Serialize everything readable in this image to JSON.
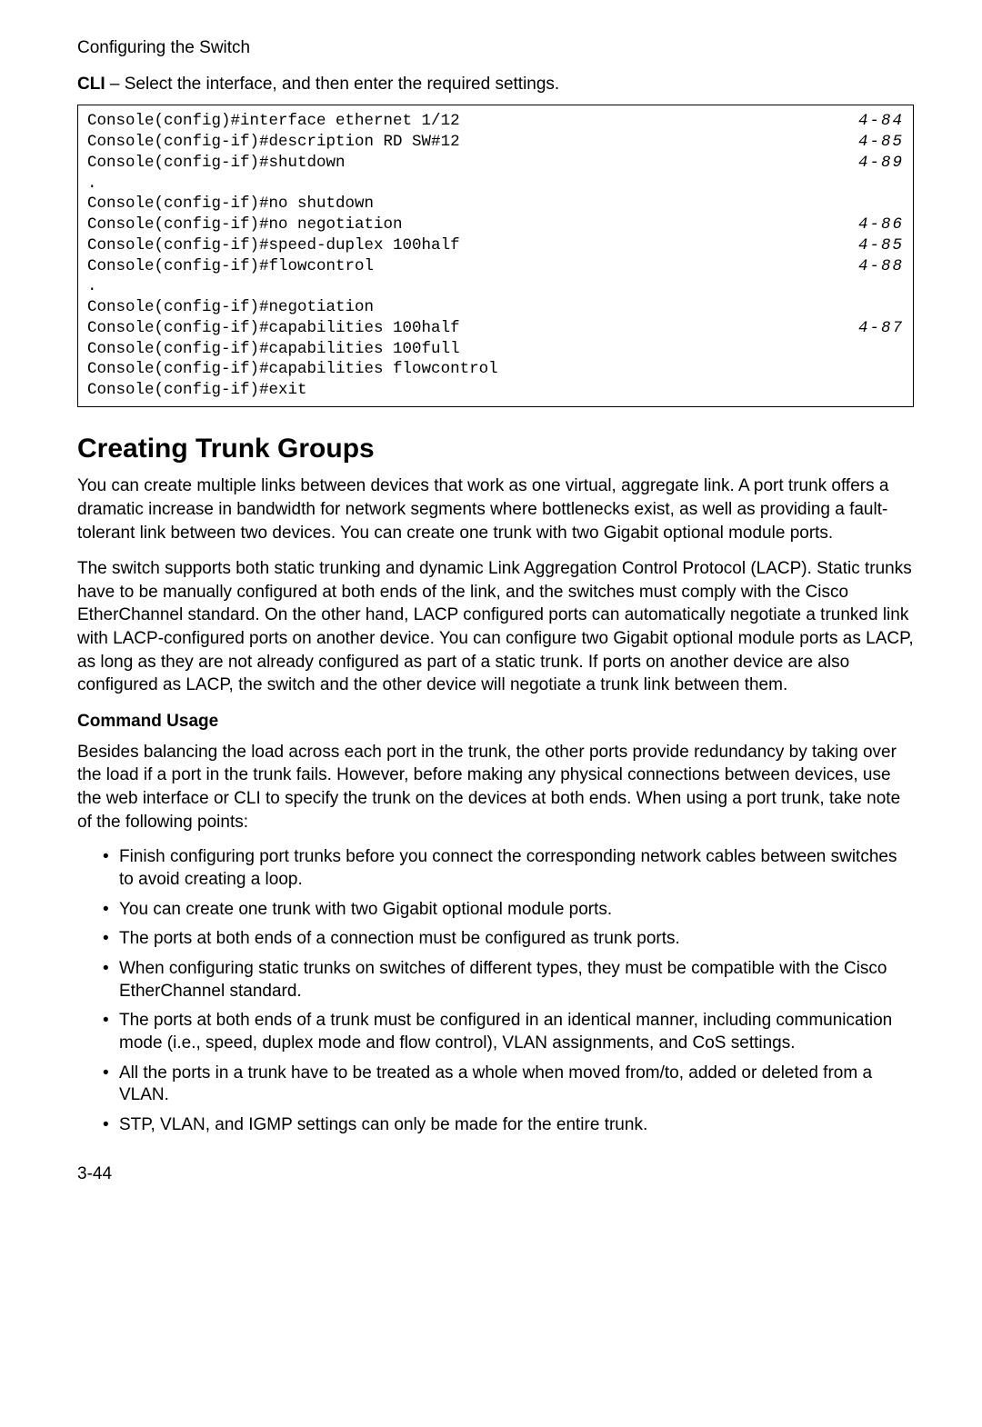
{
  "header": "Configuring the Switch",
  "cli_intro_prefix": "CLI",
  "cli_intro_rest": " – Select the interface, and then enter the required settings.",
  "code_rows": [
    {
      "left": "Console(config)#interface ethernet 1/12",
      "right": "4-84"
    },
    {
      "left": "Console(config-if)#description RD SW#12",
      "right": "4-85"
    },
    {
      "left": "Console(config-if)#shutdown",
      "right": "4-89"
    },
    {
      "left": ".",
      "right": ""
    },
    {
      "left": "Console(config-if)#no shutdown",
      "right": ""
    },
    {
      "left": "Console(config-if)#no negotiation",
      "right": "4-86"
    },
    {
      "left": "Console(config-if)#speed-duplex 100half",
      "right": "4-85"
    },
    {
      "left": "Console(config-if)#flowcontrol",
      "right": "4-88"
    },
    {
      "left": ".",
      "right": ""
    },
    {
      "left": "Console(config-if)#negotiation",
      "right": ""
    },
    {
      "left": "Console(config-if)#capabilities 100half",
      "right": "4-87"
    },
    {
      "left": "Console(config-if)#capabilities 100full",
      "right": ""
    },
    {
      "left": "Console(config-if)#capabilities flowcontrol",
      "right": ""
    },
    {
      "left": "Console(config-if)#exit",
      "right": ""
    }
  ],
  "section_title": "Creating Trunk Groups",
  "para1": "You can create multiple links between devices that work as one virtual, aggregate link. A port trunk offers a dramatic increase in bandwidth for network segments where bottlenecks exist, as well as providing a fault-tolerant link between two devices. You can create one trunk with two Gigabit optional module ports.",
  "para2": "The switch supports both static trunking and dynamic Link Aggregation Control Protocol (LACP). Static trunks have to be manually configured at both ends of the link, and the switches must comply with the Cisco EtherChannel standard. On the other hand, LACP configured ports can automatically negotiate a trunked link with LACP-configured ports on another device. You can configure two Gigabit optional module ports as LACP, as long as they are not already configured as part of a static trunk. If ports on another device are also configured as LACP, the switch and the other device will negotiate a trunk link between them.",
  "command_usage_head": "Command Usage",
  "para3": "Besides balancing the load across each port in the trunk, the other ports provide redundancy by taking over the load if a port in the trunk fails. However, before making any physical connections between devices, use the web interface or CLI to specify the trunk on the devices at both ends. When using a port trunk, take note of the following points:",
  "bullets": [
    "Finish configuring port trunks before you connect the corresponding network cables between switches to avoid creating a loop.",
    "You can create one trunk with two Gigabit optional module ports.",
    "The ports at both ends of a connection must be configured as trunk ports.",
    "When configuring static trunks on switches of different types, they must be compatible with the Cisco EtherChannel standard.",
    "The ports at both ends of a trunk must be configured in an identical manner, including communication mode (i.e., speed, duplex mode and flow control), VLAN assignments, and CoS settings.",
    "All the ports in a trunk have to be treated as a whole when moved from/to, added or deleted from a VLAN.",
    "STP, VLAN, and IGMP settings can only be made for the entire trunk."
  ],
  "page_number": "3-44"
}
